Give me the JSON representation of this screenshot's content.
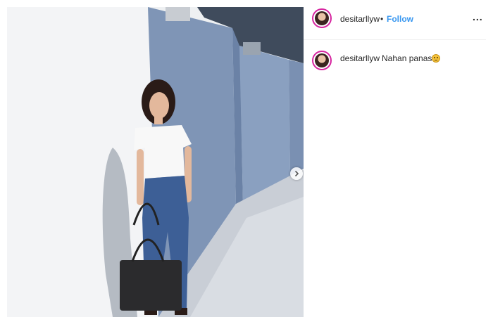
{
  "post": {
    "author": {
      "username": "desitarllyw",
      "follow_label": "Follow",
      "separator": "•"
    },
    "more_label": "...",
    "caption": {
      "username": "desitarllyw",
      "text": "Nahan panas",
      "emoji": "grimacing-face-emoji"
    },
    "carousel": {
      "next_icon": "chevron-right-icon"
    }
  },
  "colors": {
    "follow": "#3897f0",
    "avatar_ring": "#d6249f",
    "text": "#262626"
  }
}
